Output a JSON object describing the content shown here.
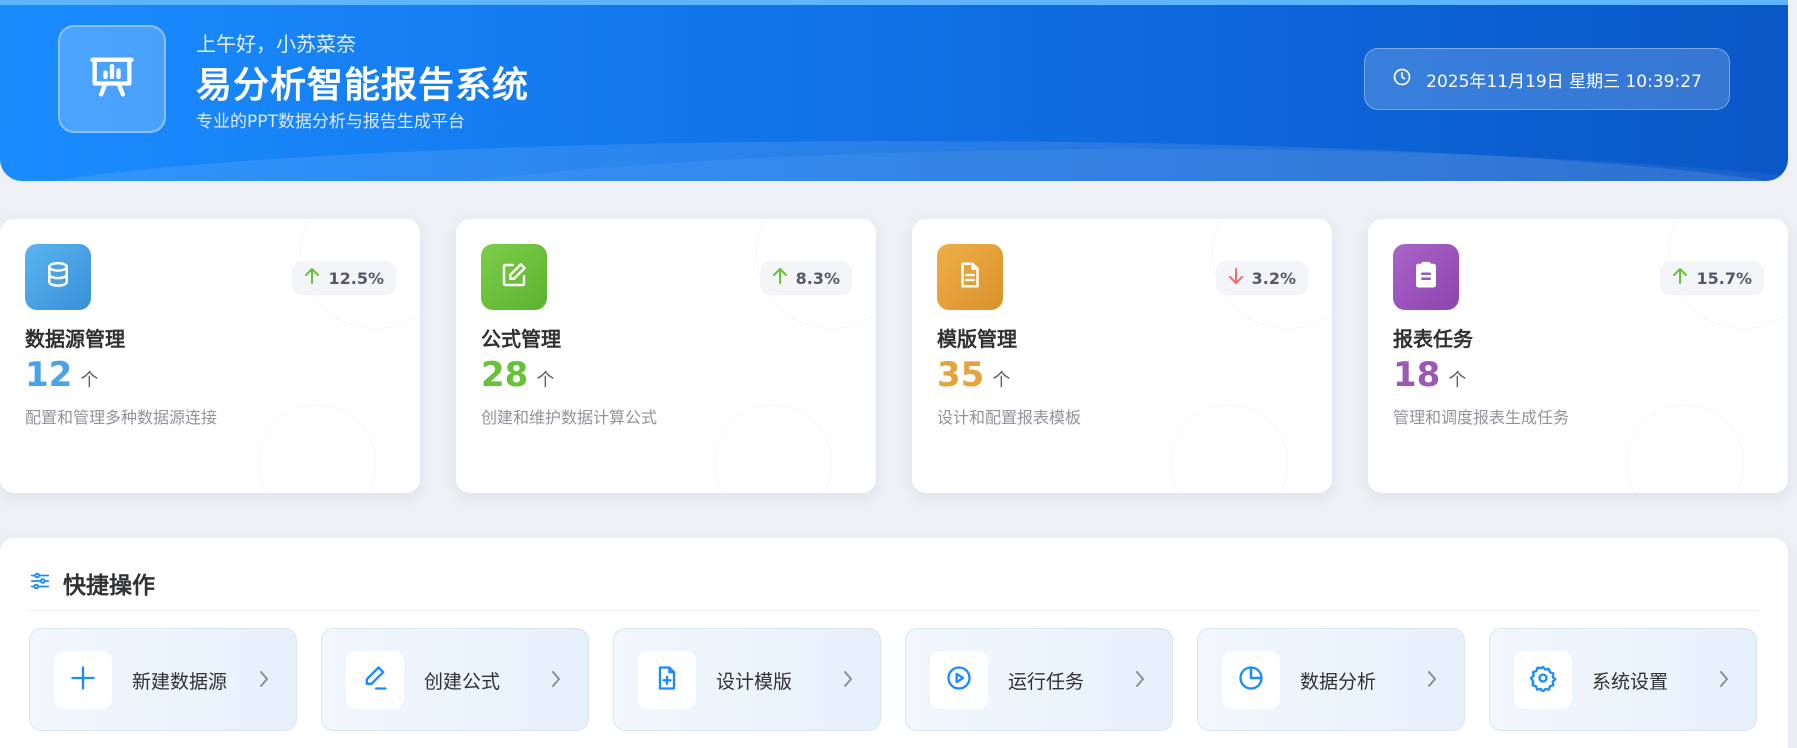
{
  "header": {
    "greeting": "上午好，小苏菜奈",
    "title": "易分析智能报告系统",
    "subtitle": "专业的PPT数据分析与报告生成平台",
    "datetime": "2025年11月19日 星期三 10:39:27",
    "logo_icon": "presentation-chart-icon",
    "clock_icon": "clock-icon",
    "colors": {
      "gradient_start": "#1a8cff",
      "gradient_end": "#0a57c7"
    }
  },
  "cards": [
    {
      "icon": "database-icon",
      "color": "#4aa3e8",
      "trend": "12.5%",
      "trend_dir": "up",
      "title": "数据源管理",
      "value": "12",
      "unit": "个",
      "desc": "配置和管理多种数据源连接"
    },
    {
      "icon": "edit-icon",
      "color": "#67c23a",
      "trend": "8.3%",
      "trend_dir": "up",
      "title": "公式管理",
      "value": "28",
      "unit": "个",
      "desc": "创建和维护数据计算公式"
    },
    {
      "icon": "document-icon",
      "color": "#e6a23c",
      "trend": "3.2%",
      "trend_dir": "down",
      "title": "模版管理",
      "value": "35",
      "unit": "个",
      "desc": "设计和配置报表模板"
    },
    {
      "icon": "clipboard-icon",
      "color": "#9b59b6",
      "trend": "15.7%",
      "trend_dir": "up",
      "title": "报表任务",
      "value": "18",
      "unit": "个",
      "desc": "管理和调度报表生成任务"
    }
  ],
  "quick_actions": {
    "title": "快捷操作",
    "icon": "sliders-icon",
    "items": [
      {
        "label": "新建数据源",
        "icon": "plus-icon"
      },
      {
        "label": "创建公式",
        "icon": "pen-icon"
      },
      {
        "label": "设计模版",
        "icon": "file-plus-icon"
      },
      {
        "label": "运行任务",
        "icon": "play-circle-icon"
      },
      {
        "label": "数据分析",
        "icon": "pie-chart-icon"
      },
      {
        "label": "系统设置",
        "icon": "gear-icon"
      }
    ]
  },
  "colors": {
    "accent": "#1a8cff",
    "trend_up": "#67c23a",
    "trend_down": "#f56c6c"
  }
}
